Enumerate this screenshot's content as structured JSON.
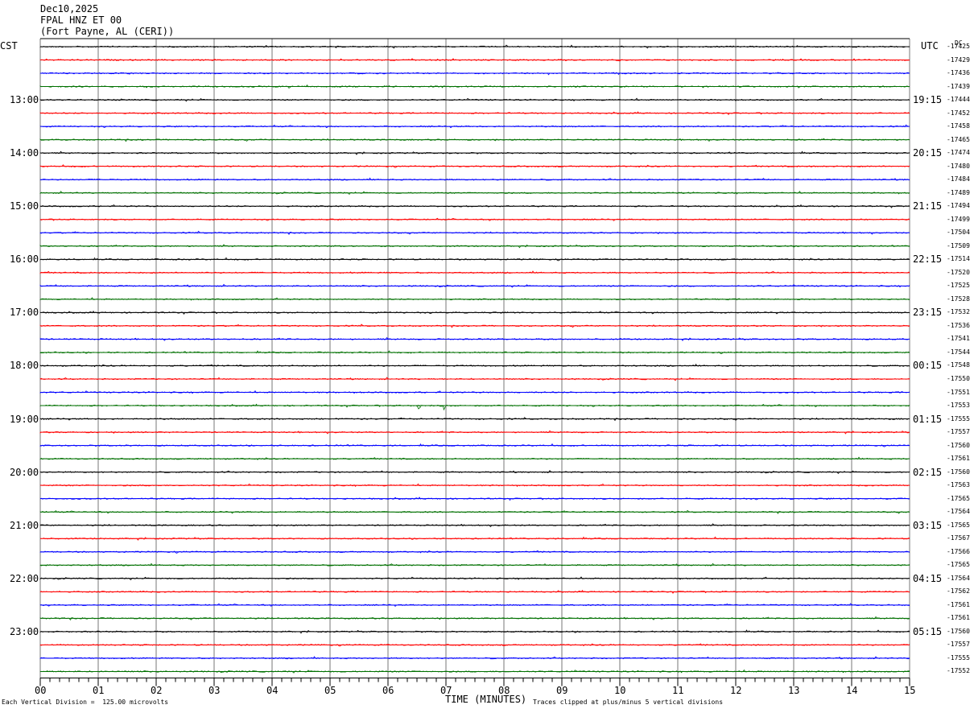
{
  "header": {
    "date": "Dec10,2025",
    "station": "FPAL HNZ ET 00",
    "location": "(Fort Payne, AL (CERI))"
  },
  "axis": {
    "left_tz": "CST",
    "right_tz": "UTC",
    "dc_label": "DC",
    "xlabel": "TIME (MINUTES)",
    "footer_left": "Each Vertical Division =  125.00 microvolts",
    "footer_right": "Traces clipped at plus/minus 5 vertical divisions"
  },
  "colors": {
    "trace": [
      "#000000",
      "#ff0000",
      "#0000ff",
      "#007000"
    ],
    "grid": "#777777"
  },
  "chart_data": {
    "type": "line",
    "title": "",
    "xlabel": "TIME (MINUTES)",
    "ylabel": "",
    "xlim": [
      0,
      15
    ],
    "x_ticks": [
      "00",
      "01",
      "02",
      "03",
      "04",
      "05",
      "06",
      "07",
      "08",
      "09",
      "10",
      "11",
      "12",
      "13",
      "14",
      "15"
    ],
    "left_hour_labels": [
      "13:00",
      "14:00",
      "15:00",
      "16:00",
      "17:00",
      "18:00",
      "19:00",
      "20:00",
      "21:00",
      "22:00",
      "23:00"
    ],
    "right_hour_labels": [
      "19:15",
      "20:15",
      "21:15",
      "22:15",
      "23:15",
      "00:15",
      "01:15",
      "02:15",
      "03:15",
      "04:15",
      "05:15"
    ],
    "dc_offsets": [
      -17425,
      -17429,
      -17436,
      -17439,
      -17444,
      -17452,
      -17458,
      -17465,
      -17474,
      -17480,
      -17484,
      -17489,
      -17494,
      -17499,
      -17504,
      -17509,
      -17514,
      -17520,
      -17525,
      -17528,
      -17532,
      -17536,
      -17541,
      -17544,
      -17548,
      -17550,
      -17551,
      -17553,
      -17555,
      -17557,
      -17560,
      -17561,
      -17560,
      -17563,
      -17565,
      -17564,
      -17565,
      -17567,
      -17566,
      -17565,
      -17564,
      -17562,
      -17561,
      -17561,
      -17560,
      -17557,
      -17555,
      -17552
    ],
    "trace_count": 48,
    "event": {
      "trace": 27,
      "minute_start": 6.5,
      "minute_end": 6.95
    }
  }
}
